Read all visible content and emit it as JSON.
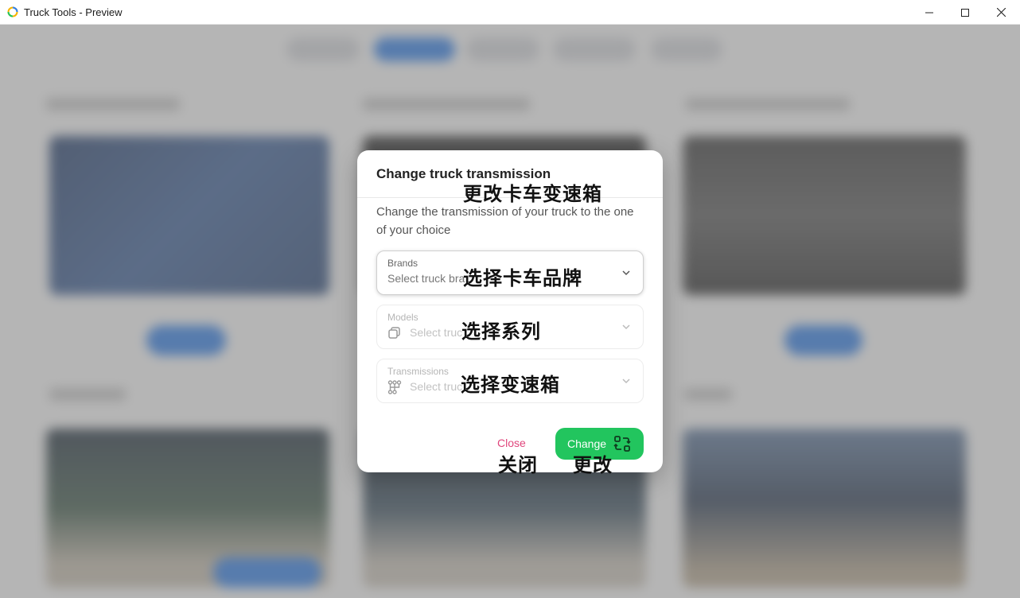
{
  "window": {
    "title": "Truck Tools - Preview"
  },
  "modal": {
    "title": "Change truck transmission",
    "description": "Change the transmission of your truck to the one of your choice",
    "fields": {
      "brands": {
        "label": "Brands",
        "placeholder": "Select truck bra"
      },
      "models": {
        "label": "Models",
        "placeholder": "Select truc"
      },
      "transmissions": {
        "label": "Transmissions",
        "placeholder": "Select truc"
      }
    },
    "close_label": "Close",
    "change_label": "Change"
  },
  "annotations": {
    "title": "更改卡车变速箱",
    "brands": "选择卡车品牌",
    "models": "选择系列",
    "transmissions": "选择变速箱",
    "close": "关闭",
    "change": "更改"
  },
  "colors": {
    "primary": "#2f80ed",
    "change_button": "#22c55e",
    "close_text": "#e0467c"
  }
}
